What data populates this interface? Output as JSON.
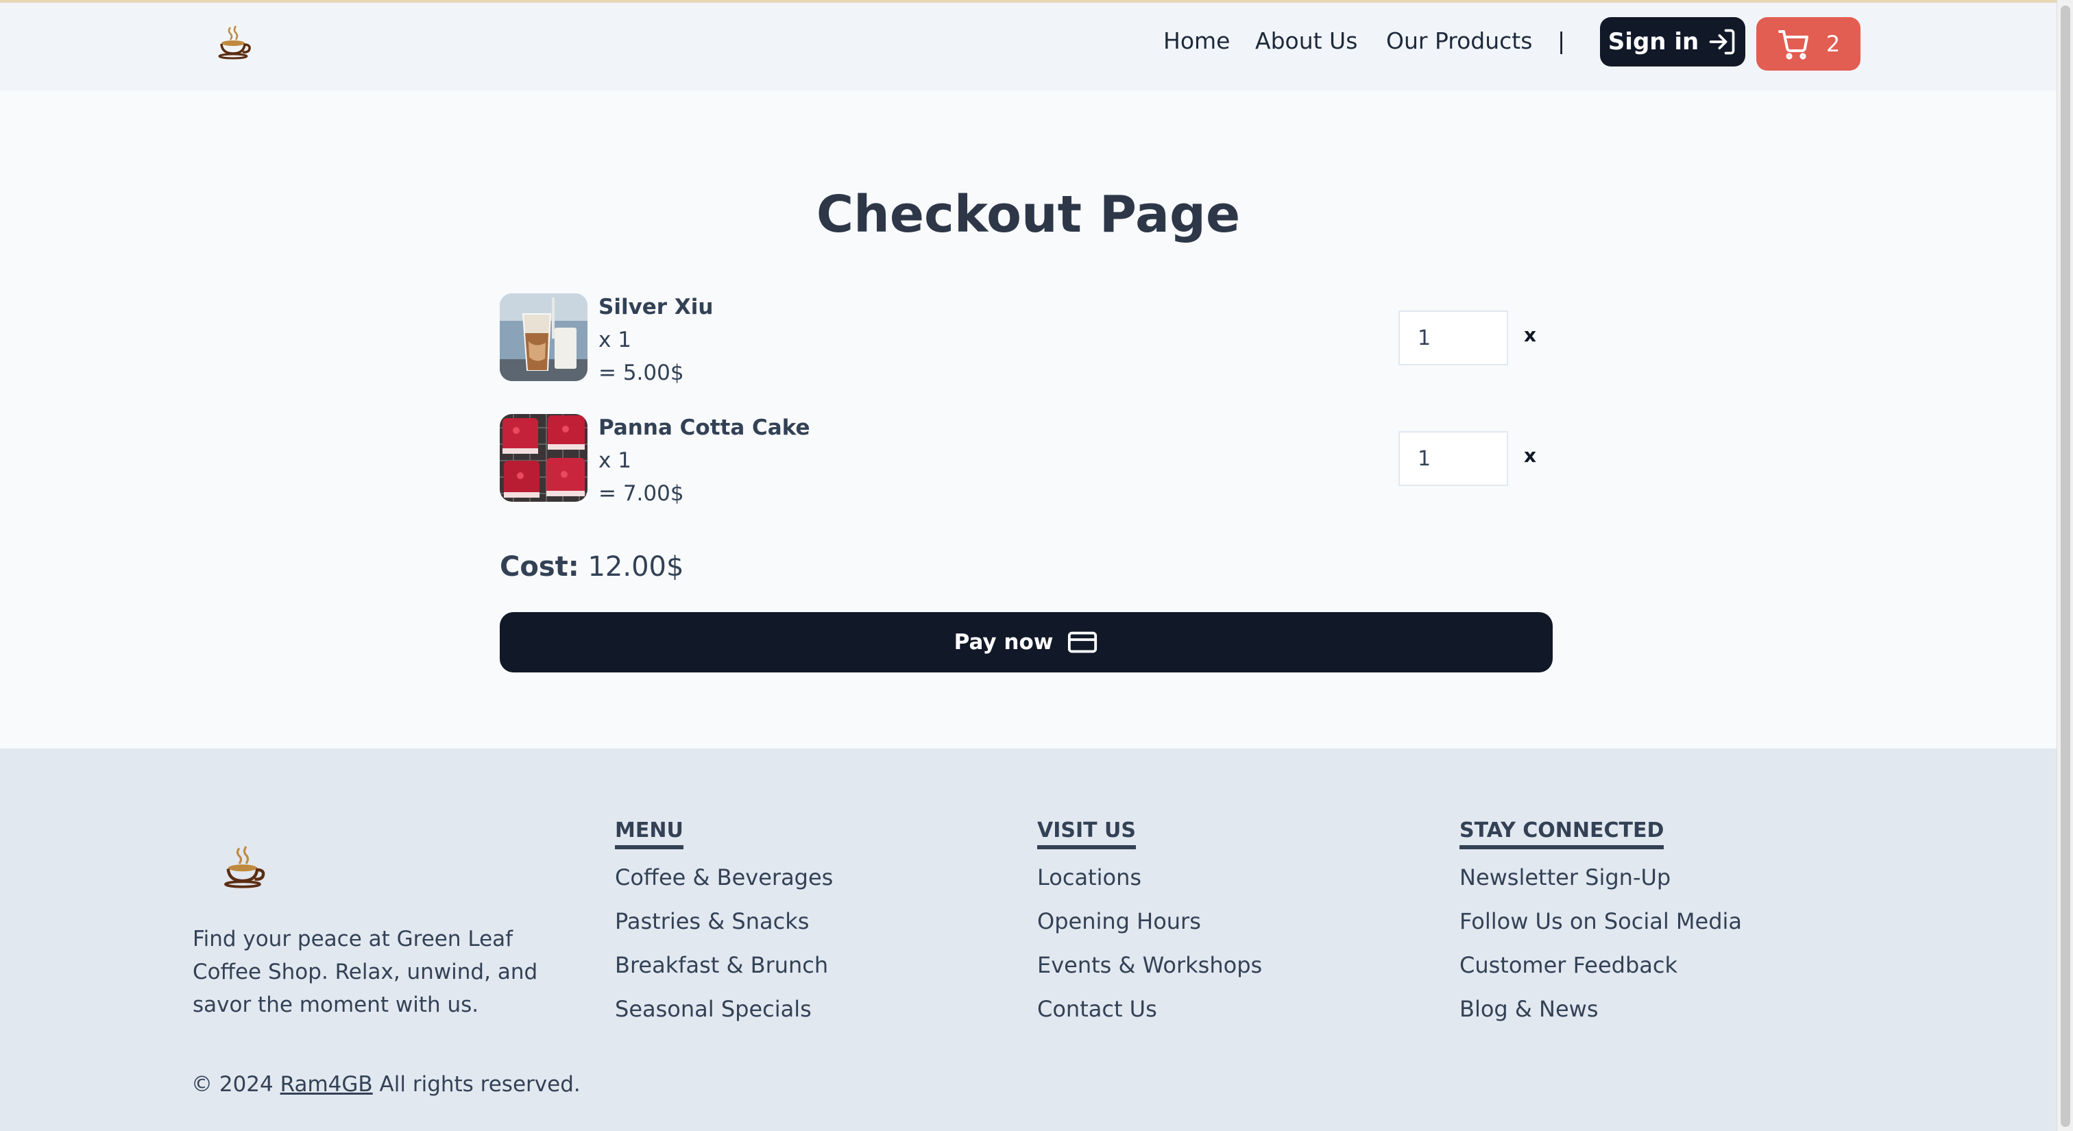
{
  "nav": {
    "links": [
      "Home",
      "About Us",
      "Our Products"
    ],
    "separator": "|",
    "signin_label": "Sign in",
    "cart_count": "2"
  },
  "page_title": "Checkout Page",
  "cart": {
    "items": [
      {
        "name": "Silver Xiu",
        "qty_text": "x 1",
        "total_text": "= 5.00$",
        "qty_value": "1",
        "remove": "x"
      },
      {
        "name": "Panna Cotta Cake",
        "qty_text": "x 1",
        "total_text": "= 7.00$",
        "qty_value": "1",
        "remove": "x"
      }
    ],
    "cost_label": "Cost:",
    "cost_value": "12.00$",
    "pay_label": "Pay now"
  },
  "footer": {
    "tagline": "Find your peace at Green Leaf Coffee Shop. Relax, unwind, and savor the moment with us.",
    "columns": [
      {
        "heading": "MENU",
        "items": [
          "Coffee & Beverages",
          "Pastries & Snacks",
          "Breakfast & Brunch",
          "Seasonal Specials"
        ]
      },
      {
        "heading": "VISIT US",
        "items": [
          "Locations",
          "Opening Hours",
          "Events & Workshops",
          "Contact Us"
        ]
      },
      {
        "heading": "STAY CONNECTED",
        "items": [
          "Newsletter Sign-Up",
          "Follow Us on Social Media",
          "Customer Feedback",
          "Blog & News"
        ]
      }
    ],
    "copyright_prefix": "© 2024",
    "copyright_owner": "Ram4GB",
    "copyright_suffix": "All rights reserved."
  },
  "colors": {
    "primary_dark": "#111827",
    "cart_red": "#e25d52",
    "text": "#334155",
    "footer_bg": "#e2e8f0"
  },
  "icons": [
    "coffee-cup-logo-icon",
    "sign-in-arrow-icon",
    "shopping-cart-icon",
    "credit-card-icon"
  ]
}
